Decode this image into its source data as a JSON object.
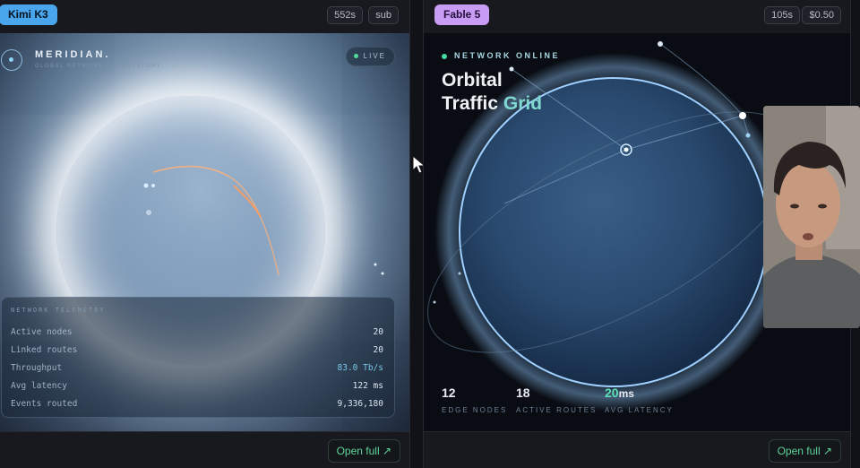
{
  "left_panel": {
    "model_badge": "Kimi K3",
    "time_chip": "552s",
    "mode_chip": "sub",
    "open_full": "Open full ↗",
    "app": {
      "title": "MERIDIAN.",
      "subtitle": "GLOBAL NETWORK OBSERVATORY",
      "live": "LIVE"
    },
    "telemetry": {
      "title": "NETWORK TELEMETRY",
      "rows": [
        {
          "label": "Active nodes",
          "value": "20"
        },
        {
          "label": "Linked routes",
          "value": "20"
        },
        {
          "label": "Throughput",
          "value": "83.0 Tb/s"
        },
        {
          "label": "Avg latency",
          "value": "122 ms"
        },
        {
          "label": "Events routed",
          "value": "9,336,180"
        }
      ]
    }
  },
  "right_panel": {
    "model_badge": "Fable 5",
    "time_chip": "105s",
    "cost_chip": "$0.50",
    "open_full": "Open full ↗",
    "app": {
      "status": "NETWORK ONLINE",
      "title_line1": "Orbital",
      "title_line2_a": "Traffic ",
      "title_line2_b": "Grid",
      "stats": [
        {
          "value": "12",
          "unit": "",
          "label": "EDGE NODES"
        },
        {
          "value": "18",
          "unit": "",
          "label": "ACTIVE ROUTES"
        },
        {
          "value": "20",
          "unit": "ms",
          "label": "AVG LATENCY"
        }
      ]
    }
  },
  "colors": {
    "kimi_badge": "#4aa6ec",
    "fable_badge": "#c89cf4",
    "open_full": "#5fd39a",
    "live_dot": "#4fd99a",
    "latency_accent": "#5ee0b4"
  },
  "icons": {
    "cursor": "mouse-pointer-icon",
    "logo": "meridian-logo-icon",
    "external": "arrow-up-right-icon"
  }
}
